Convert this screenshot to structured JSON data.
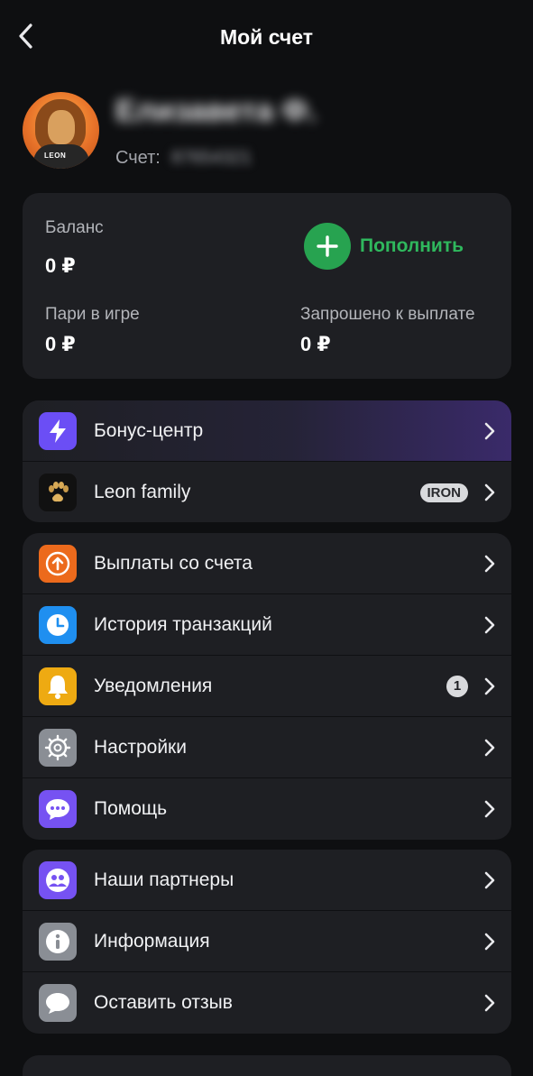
{
  "header": {
    "title": "Мой счет"
  },
  "profile": {
    "name": "Елизавета Ф.",
    "account_label": "Счет:",
    "account_number": "87654321",
    "avatar_brand": "LEON"
  },
  "balance": {
    "balance_label": "Баланс",
    "balance_value": "0 ₽",
    "deposit_label": "Пополнить",
    "bets_label": "Пари в игре",
    "bets_value": "0 ₽",
    "withdraw_label": "Запрошено к выплате",
    "withdraw_value": "0 ₽"
  },
  "group1": [
    {
      "label": "Бонус-центр",
      "icon": "lightning-icon",
      "color": "#6b4ef5"
    },
    {
      "label": "Leon family",
      "icon": "paw-icon",
      "color": "#111111",
      "badge": "IRON"
    }
  ],
  "group2": [
    {
      "label": "Выплаты со счета",
      "icon": "arrow-up-circle-icon",
      "color": "#ec6a1c"
    },
    {
      "label": "История транзакций",
      "icon": "clock-icon",
      "color": "#1f8ff0"
    },
    {
      "label": "Уведомления",
      "icon": "bell-icon",
      "color": "#eeaa12",
      "badge": "1"
    },
    {
      "label": "Настройки",
      "icon": "gear-icon",
      "color": "#8a8e95"
    },
    {
      "label": "Помощь",
      "icon": "chat-bubble-icon",
      "color": "#7652f2"
    }
  ],
  "group3": [
    {
      "label": "Наши партнеры",
      "icon": "people-icon",
      "color": "#7652f2"
    },
    {
      "label": "Информация",
      "icon": "info-icon",
      "color": "#8a8e95"
    },
    {
      "label": "Оставить отзыв",
      "icon": "speech-bubble-icon",
      "color": "#8a8e95"
    }
  ]
}
